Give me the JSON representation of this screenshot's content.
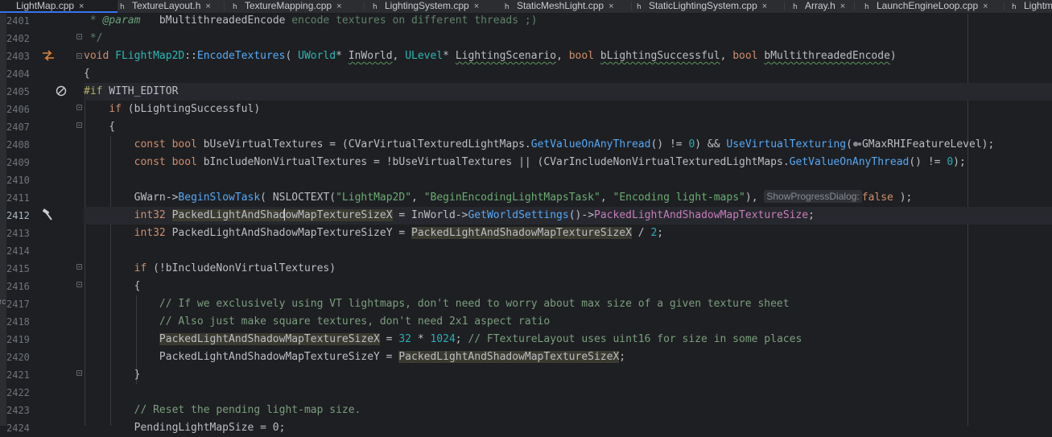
{
  "tabs": [
    {
      "label": "LightMap.cpp",
      "active": true,
      "icon": "cpp-file-icon"
    },
    {
      "label": "TextureLayout.h",
      "active": false,
      "icon": "header-file-icon"
    },
    {
      "label": "TextureMapping.cpp",
      "active": false,
      "icon": "cpp-file-icon"
    },
    {
      "label": "LightingSystem.cpp",
      "active": false,
      "icon": "cpp-file-icon"
    },
    {
      "label": "StaticMeshLight.cpp",
      "active": false,
      "icon": "cpp-file-icon"
    },
    {
      "label": "StaticLightingSystem.cpp",
      "active": false,
      "icon": "cpp-file-icon"
    },
    {
      "label": "Array.h",
      "active": false,
      "icon": "header-file-icon"
    },
    {
      "label": "LaunchEngineLoop.cpp",
      "active": false,
      "icon": "cpp-file-icon"
    },
    {
      "label": "Lightm",
      "active": false,
      "icon": "cpp-file-icon"
    }
  ],
  "tab_close_glyph": "×",
  "edge_text": "rc",
  "line_numbers": [
    "2401",
    "2402",
    "2403",
    "2404",
    "2405",
    "2406",
    "2407",
    "2408",
    "2409",
    "2410",
    "2411",
    "2412",
    "2413",
    "2414",
    "2415",
    "2416",
    "2417",
    "2418",
    "2419",
    "2420",
    "2421",
    "2422",
    "2423",
    "2424"
  ],
  "code": {
    "l2401_a": " * ",
    "l2401_tag": "@param",
    "l2401_b": "   bMultithreadedEncode",
    "l2401_c": " encode textures on different threads ;)",
    "l2402": " */",
    "l2403_void": "void",
    "l2403_cls": "FLightMap2D",
    "l2403_sep": "::",
    "l2403_fn": "EncodeTextures",
    "l2403_p1": "( ",
    "l2403_t1": "UWorld",
    "l2403_s1": "* ",
    "l2403_a1": "InWorld",
    "l2403_c1": ", ",
    "l2403_t2": "ULevel",
    "l2403_s2": "* ",
    "l2403_a2": "LightingScenario",
    "l2403_c2": ", ",
    "l2403_t3": "bool",
    "l2403_sp3": " ",
    "l2403_a3": "bLightingSuccessful",
    "l2403_c3": ", ",
    "l2403_t4": "bool",
    "l2403_sp4": " ",
    "l2403_a4": "bMultithreadedEncode",
    "l2403_end": ")",
    "l2404": "{",
    "l2405_pp": "#if",
    "l2405_m": " WITH_EDITOR",
    "l2406_ind": "    ",
    "l2406_kw": "if",
    "l2406_r": " (bLightingSuccessful)",
    "l2407": "    {",
    "l2408_ind": "        ",
    "l2408_k1": "const",
    "l2408_sp1": " ",
    "l2408_k2": "bool",
    "l2408_v": " bUseVirtualTextures",
    "l2408_eq": " = (",
    "l2408_g": "CVarVirtualTexturedLightMaps",
    "l2408_dot": ".",
    "l2408_f": "GetValueOnAnyThread",
    "l2408_r": "() != ",
    "l2408_n": "0",
    "l2408_and": ") && ",
    "l2408_f2": "UseVirtualTexturing",
    "l2408_p": "(",
    "l2408_g2": "GMaxRHIFeatureLevel",
    "l2408_end": ");",
    "l2409_ind": "        ",
    "l2409_k1": "const",
    "l2409_sp1": " ",
    "l2409_k2": "bool",
    "l2409_v": " bIncludeNonVirtualTextures",
    "l2409_eq": " = !bUseVirtualTextures || (",
    "l2409_g": "CVarIncludeNonVirtualTexturedLightMaps",
    "l2409_dot": ".",
    "l2409_f": "GetValueOnAnyThread",
    "l2409_r": "() != ",
    "l2409_n": "0",
    "l2409_end": ");",
    "l2411_ind": "        ",
    "l2411_g": "GWarn",
    "l2411_arr": "->",
    "l2411_f": "BeginSlowTask",
    "l2411_p": "( ",
    "l2411_m": "NSLOCTEXT",
    "l2411_p2": "(",
    "l2411_s1": "\"LightMap2D\"",
    "l2411_c1": ", ",
    "l2411_s2": "\"BeginEncodingLightMapsTask\"",
    "l2411_c2": ", ",
    "l2411_s3": "\"Encoding light-maps\"",
    "l2411_c3": "), ",
    "l2411_hint": "ShowProgressDialog:",
    "l2411_kw": "false",
    "l2411_end": " );",
    "l2412_ind": "        ",
    "l2412_t": "int32",
    "l2412_sp": " ",
    "l2412_v1": "PackedLightAndShad",
    "l2412_v2": "owMapTextureSizeX",
    "l2412_eq": " = ",
    "l2412_a": "InWorld",
    "l2412_arr": "->",
    "l2412_f": "GetWorldSettings",
    "l2412_r": "()->",
    "l2412_fld": "PackedLightAndShadowMapTextureSize",
    "l2412_end": ";",
    "l2413_ind": "        ",
    "l2413_t": "int32",
    "l2413_v": " PackedLightAndShadowMapTextureSizeY",
    "l2413_eq": " = ",
    "l2413_u": "PackedLightAndShadowMapTextureSizeX",
    "l2413_div": " / ",
    "l2413_n": "2",
    "l2413_end": ";",
    "l2415_ind": "        ",
    "l2415_kw": "if",
    "l2415_r": " (!bIncludeNonVirtualTextures)",
    "l2416": "        {",
    "l2417_ind": "            ",
    "l2417_cm": "// If we exclusively using VT lightmaps, don't need to worry about max size of a given texture sheet",
    "l2418_ind": "            ",
    "l2418_cm": "// Also just make square textures, don't need 2x1 aspect ratio",
    "l2419_ind": "            ",
    "l2419_u": "PackedLightAndShadowMapTextureSizeX",
    "l2419_eq": " = ",
    "l2419_n1": "32",
    "l2419_mul": " * ",
    "l2419_n2": "1024",
    "l2419_sc": "; ",
    "l2419_cm": "// FTextureLayout uses uint16 for size in some places",
    "l2420_ind": "            ",
    "l2420_v": "PackedLightAndShadowMapTextureSizeY",
    "l2420_eq": " = ",
    "l2420_u": "PackedLightAndShadowMapTextureSizeX",
    "l2420_end": ";",
    "l2421": "        }",
    "l2423_ind": "        ",
    "l2423_cm": "// Reset the pending light-map size.",
    "l2424": "        PendingLightMapSize = 0;"
  },
  "colors": {
    "editor_bg": "#1e1f22",
    "keyword": "#cf8e6d",
    "function": "#56a8f5",
    "comment": "#7a9e7e",
    "string": "#6aab73",
    "number": "#2aacb8",
    "param": "#c77dbb",
    "preprocessor": "#b3ae60"
  }
}
